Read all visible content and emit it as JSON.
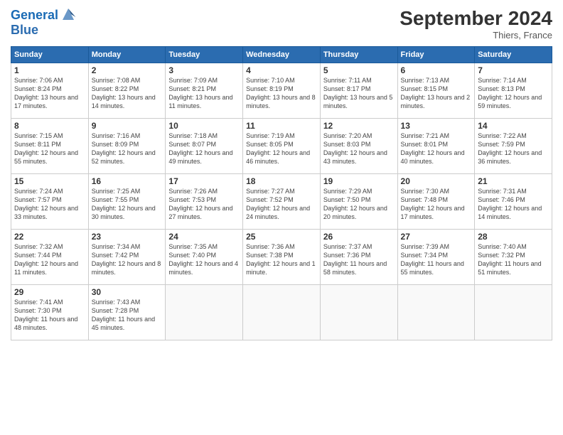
{
  "header": {
    "logo_line1": "General",
    "logo_line2": "Blue",
    "month": "September 2024",
    "location": "Thiers, France"
  },
  "days_of_week": [
    "Sunday",
    "Monday",
    "Tuesday",
    "Wednesday",
    "Thursday",
    "Friday",
    "Saturday"
  ],
  "weeks": [
    [
      {
        "day": "1",
        "info": "Sunrise: 7:06 AM\nSunset: 8:24 PM\nDaylight: 13 hours and 17 minutes."
      },
      {
        "day": "2",
        "info": "Sunrise: 7:08 AM\nSunset: 8:22 PM\nDaylight: 13 hours and 14 minutes."
      },
      {
        "day": "3",
        "info": "Sunrise: 7:09 AM\nSunset: 8:21 PM\nDaylight: 13 hours and 11 minutes."
      },
      {
        "day": "4",
        "info": "Sunrise: 7:10 AM\nSunset: 8:19 PM\nDaylight: 13 hours and 8 minutes."
      },
      {
        "day": "5",
        "info": "Sunrise: 7:11 AM\nSunset: 8:17 PM\nDaylight: 13 hours and 5 minutes."
      },
      {
        "day": "6",
        "info": "Sunrise: 7:13 AM\nSunset: 8:15 PM\nDaylight: 13 hours and 2 minutes."
      },
      {
        "day": "7",
        "info": "Sunrise: 7:14 AM\nSunset: 8:13 PM\nDaylight: 12 hours and 59 minutes."
      }
    ],
    [
      {
        "day": "8",
        "info": "Sunrise: 7:15 AM\nSunset: 8:11 PM\nDaylight: 12 hours and 55 minutes."
      },
      {
        "day": "9",
        "info": "Sunrise: 7:16 AM\nSunset: 8:09 PM\nDaylight: 12 hours and 52 minutes."
      },
      {
        "day": "10",
        "info": "Sunrise: 7:18 AM\nSunset: 8:07 PM\nDaylight: 12 hours and 49 minutes."
      },
      {
        "day": "11",
        "info": "Sunrise: 7:19 AM\nSunset: 8:05 PM\nDaylight: 12 hours and 46 minutes."
      },
      {
        "day": "12",
        "info": "Sunrise: 7:20 AM\nSunset: 8:03 PM\nDaylight: 12 hours and 43 minutes."
      },
      {
        "day": "13",
        "info": "Sunrise: 7:21 AM\nSunset: 8:01 PM\nDaylight: 12 hours and 40 minutes."
      },
      {
        "day": "14",
        "info": "Sunrise: 7:22 AM\nSunset: 7:59 PM\nDaylight: 12 hours and 36 minutes."
      }
    ],
    [
      {
        "day": "15",
        "info": "Sunrise: 7:24 AM\nSunset: 7:57 PM\nDaylight: 12 hours and 33 minutes."
      },
      {
        "day": "16",
        "info": "Sunrise: 7:25 AM\nSunset: 7:55 PM\nDaylight: 12 hours and 30 minutes."
      },
      {
        "day": "17",
        "info": "Sunrise: 7:26 AM\nSunset: 7:53 PM\nDaylight: 12 hours and 27 minutes."
      },
      {
        "day": "18",
        "info": "Sunrise: 7:27 AM\nSunset: 7:52 PM\nDaylight: 12 hours and 24 minutes."
      },
      {
        "day": "19",
        "info": "Sunrise: 7:29 AM\nSunset: 7:50 PM\nDaylight: 12 hours and 20 minutes."
      },
      {
        "day": "20",
        "info": "Sunrise: 7:30 AM\nSunset: 7:48 PM\nDaylight: 12 hours and 17 minutes."
      },
      {
        "day": "21",
        "info": "Sunrise: 7:31 AM\nSunset: 7:46 PM\nDaylight: 12 hours and 14 minutes."
      }
    ],
    [
      {
        "day": "22",
        "info": "Sunrise: 7:32 AM\nSunset: 7:44 PM\nDaylight: 12 hours and 11 minutes."
      },
      {
        "day": "23",
        "info": "Sunrise: 7:34 AM\nSunset: 7:42 PM\nDaylight: 12 hours and 8 minutes."
      },
      {
        "day": "24",
        "info": "Sunrise: 7:35 AM\nSunset: 7:40 PM\nDaylight: 12 hours and 4 minutes."
      },
      {
        "day": "25",
        "info": "Sunrise: 7:36 AM\nSunset: 7:38 PM\nDaylight: 12 hours and 1 minute."
      },
      {
        "day": "26",
        "info": "Sunrise: 7:37 AM\nSunset: 7:36 PM\nDaylight: 11 hours and 58 minutes."
      },
      {
        "day": "27",
        "info": "Sunrise: 7:39 AM\nSunset: 7:34 PM\nDaylight: 11 hours and 55 minutes."
      },
      {
        "day": "28",
        "info": "Sunrise: 7:40 AM\nSunset: 7:32 PM\nDaylight: 11 hours and 51 minutes."
      }
    ],
    [
      {
        "day": "29",
        "info": "Sunrise: 7:41 AM\nSunset: 7:30 PM\nDaylight: 11 hours and 48 minutes."
      },
      {
        "day": "30",
        "info": "Sunrise: 7:43 AM\nSunset: 7:28 PM\nDaylight: 11 hours and 45 minutes."
      },
      {
        "day": "",
        "info": ""
      },
      {
        "day": "",
        "info": ""
      },
      {
        "day": "",
        "info": ""
      },
      {
        "day": "",
        "info": ""
      },
      {
        "day": "",
        "info": ""
      }
    ]
  ]
}
